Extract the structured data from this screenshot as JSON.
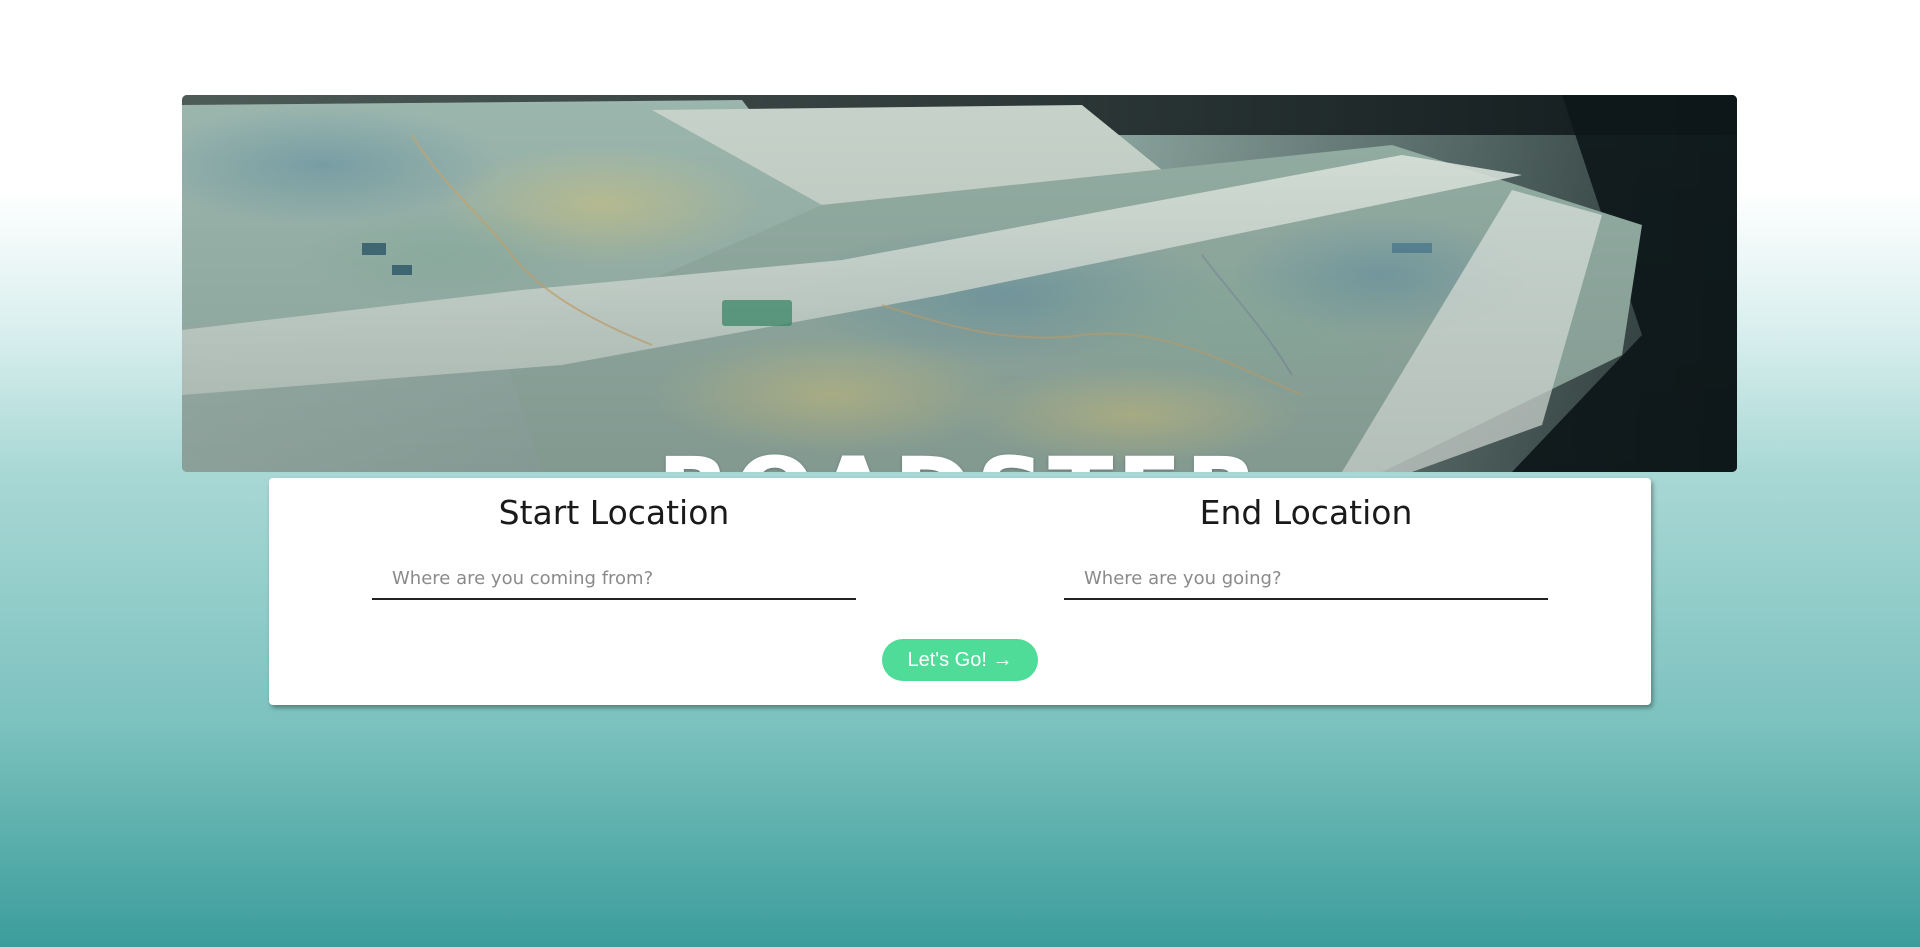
{
  "hero": {
    "title": "ROADSTER",
    "image": "folded-map-photo"
  },
  "form": {
    "start": {
      "label": "Start Location",
      "placeholder": "Where are you coming from?",
      "value": ""
    },
    "end": {
      "label": "End Location",
      "placeholder": "Where are you going?",
      "value": ""
    },
    "submit_label": "Let's Go! →"
  },
  "colors": {
    "button": "#4fdb98",
    "gradient_bottom": "#3b9d9b",
    "gradient_mid": "#7dc2bf",
    "card": "#ffffff"
  }
}
